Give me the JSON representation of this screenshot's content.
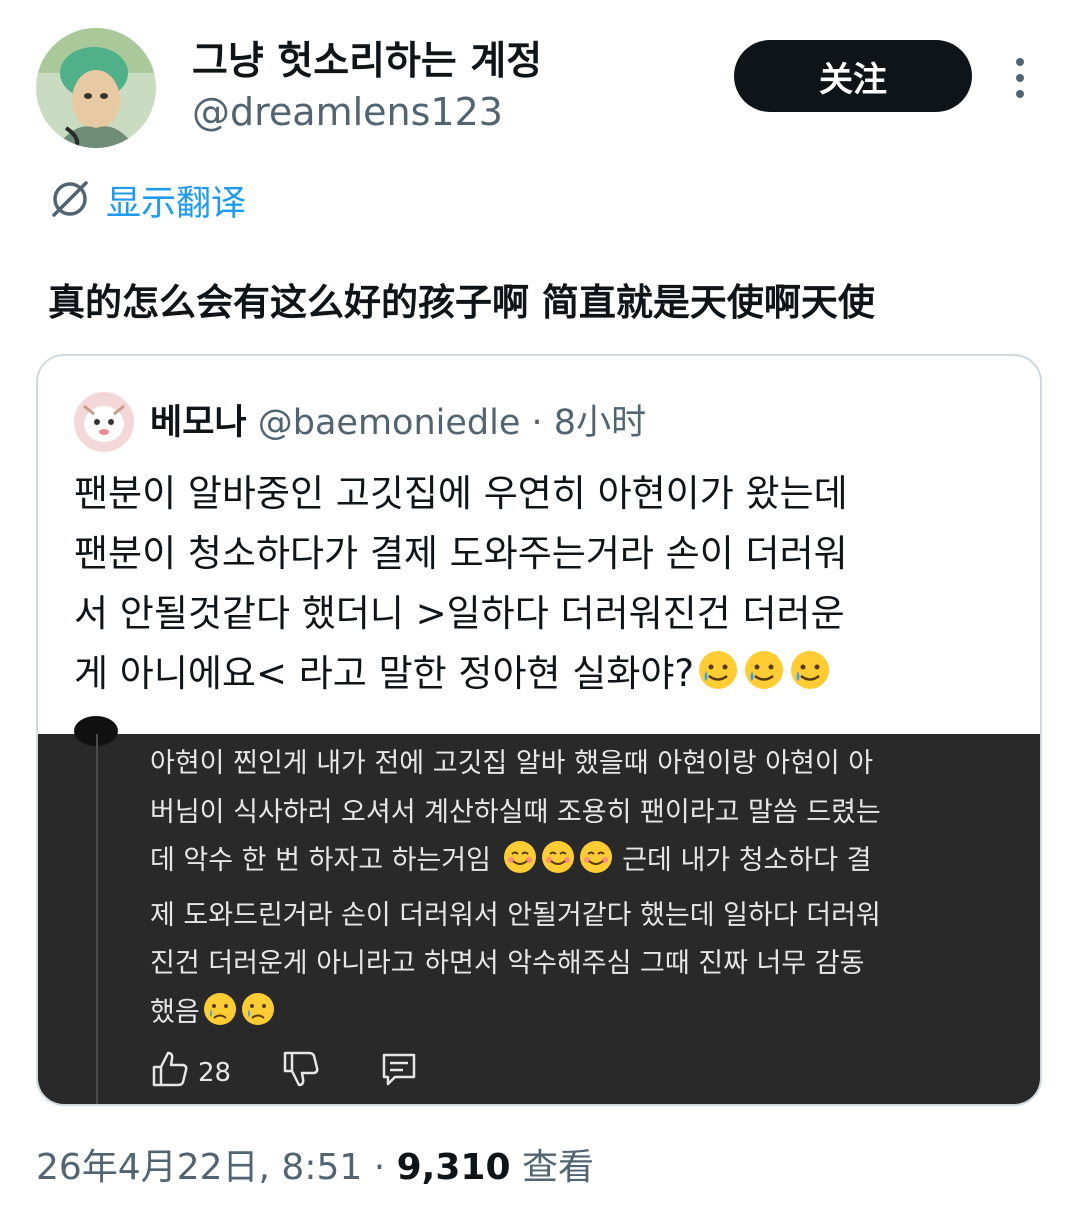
{
  "author": {
    "display_name": "그냥 헛소리하는 계정",
    "handle": "@dreamlens123",
    "avatar": "avatar-green-hair-character"
  },
  "follow_label": "关注",
  "more_icon": "more-vertical-icon",
  "translate_label": "显示翻译",
  "tweet_text": "真的怎么会有这么好的孩子啊 简直就是天使啊天使",
  "quote": {
    "display_name": "베모나",
    "handle": "@baemoniedle",
    "separator": "·",
    "time": "8小时",
    "body_lines": [
      "팬분이 알바중인 고깃집에 우연히 아현이가 왔는데",
      "팬분이 청소하다가 결제 도와주는거라 손이 더러워",
      "서 안될것같다 했더니 >일하다 더러워진건 더러운",
      "게 아니에요< 라고 말한 정아현 실화야?"
    ],
    "body_emojis": [
      "smiling-face-with-tear",
      "smiling-face-with-tear",
      "smiling-face-with-tear"
    ],
    "screenshot": {
      "lines": [
        "아현이 찐인게 내가 전에 고깃집 알바 했을때 아현이랑 아현이 아",
        "버님이 식사하러 오셔서 계산하실때 조용히 팬이라고 말씀 드렸는",
        "데 악수 한 번 하자고 하는거임",
        "근데 내가 청소하다 결",
        "제 도와드린거라 손이 더러워서 안될거같다 했는데 일하다 더러워",
        "진건 더러운게 아니라고 하면서 악수해주심 그때 진짜 너무 감동",
        "했음"
      ],
      "like_count": "28",
      "icons": [
        "thumbs-up-icon",
        "thumbs-down-icon",
        "comment-icon"
      ]
    }
  },
  "meta": {
    "datetime": "26年4月22日, 8:51",
    "separator": "·",
    "views": "9,310",
    "views_label": "查看"
  },
  "colors": {
    "text_primary": "#0f1419",
    "text_secondary": "#536471",
    "link_blue": "#1d9bf0",
    "follow_bg": "#0f1419",
    "screenshot_bg": "#292929"
  }
}
